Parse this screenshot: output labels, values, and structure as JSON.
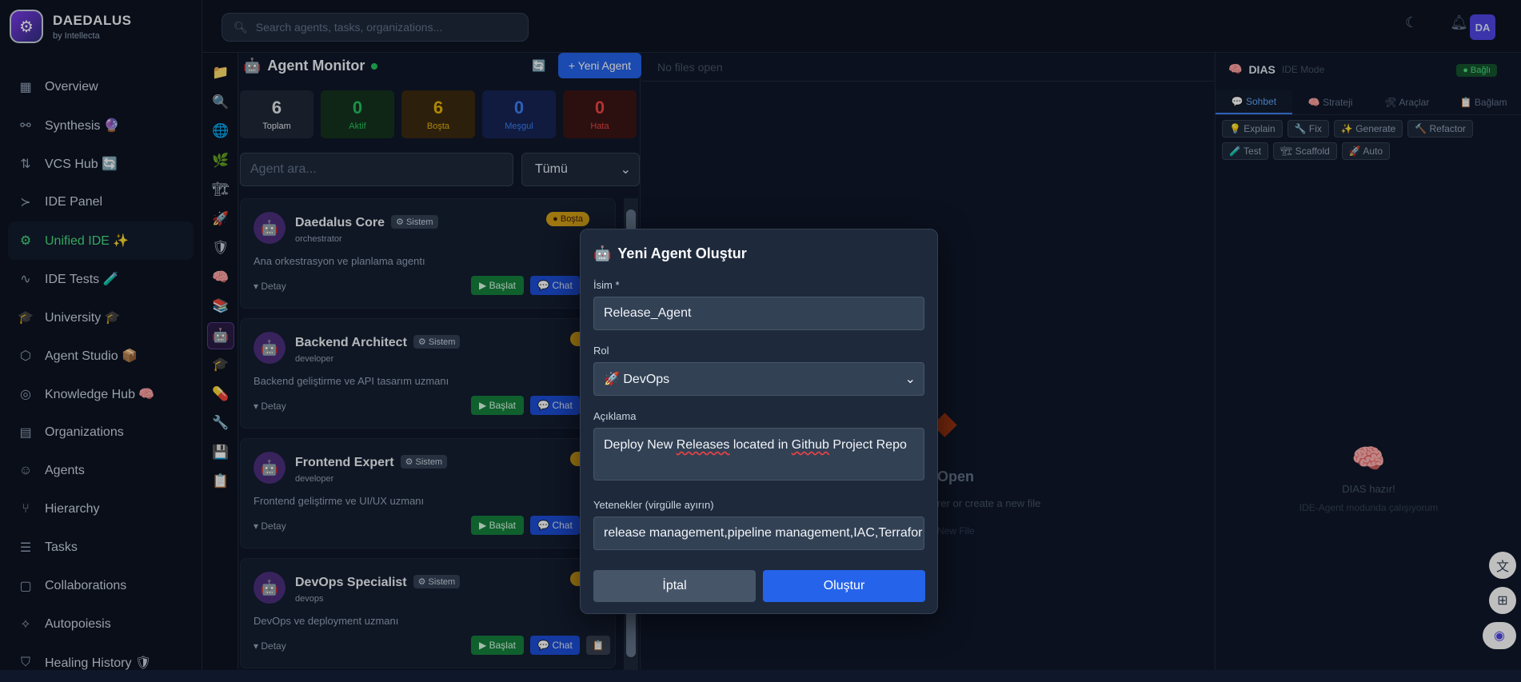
{
  "brand": {
    "title": "DAEDALUS",
    "subtitle": "by Intellecta"
  },
  "search": {
    "placeholder": "Search agents, tasks, organizations..."
  },
  "user": {
    "initials": "DA"
  },
  "nav": [
    {
      "label": "Overview",
      "icon": "▦",
      "name": "overview"
    },
    {
      "label": "Synthesis 🔮",
      "icon": "⚯",
      "name": "synthesis"
    },
    {
      "label": "VCS Hub 🔄",
      "icon": "⇅",
      "name": "vcs-hub"
    },
    {
      "label": "IDE Panel",
      "icon": "≻",
      "name": "ide-panel"
    },
    {
      "label": "Unified IDE ✨",
      "icon": "⚙",
      "name": "unified-ide"
    },
    {
      "label": "IDE Tests 🧪",
      "icon": "∿",
      "name": "ide-tests"
    },
    {
      "label": "University 🎓",
      "icon": "🎓",
      "name": "university"
    },
    {
      "label": "Agent Studio 📦",
      "icon": "⬡",
      "name": "agent-studio"
    },
    {
      "label": "Knowledge Hub 🧠",
      "icon": "◎",
      "name": "knowledge-hub"
    },
    {
      "label": "Organizations",
      "icon": "▤",
      "name": "organizations"
    },
    {
      "label": "Agents",
      "icon": "☺",
      "name": "agents"
    },
    {
      "label": "Hierarchy",
      "icon": "⑂",
      "name": "hierarchy"
    },
    {
      "label": "Tasks",
      "icon": "☰",
      "name": "tasks"
    },
    {
      "label": "Collaborations",
      "icon": "▢",
      "name": "collaborations"
    },
    {
      "label": "Autopoiesis",
      "icon": "✧",
      "name": "autopoiesis"
    },
    {
      "label": "Healing History 🛡",
      "icon": "⛉",
      "name": "healing-history"
    }
  ],
  "rail": [
    "📁",
    "🔍",
    "🌐",
    "🌿",
    "🏗",
    "🚀",
    "🛡",
    "🧠",
    "📚",
    "🤖",
    "🎓",
    "💊",
    "🔧",
    "💾",
    "📋"
  ],
  "monitor": {
    "title": "Agent Monitor",
    "new_agent": "+ Yeni Agent",
    "search_placeholder": "Agent ara...",
    "filter": "Tümü",
    "stats": [
      {
        "value": "6",
        "label": "Toplam",
        "bg": "#1f2937",
        "color": "#e5e7eb"
      },
      {
        "value": "0",
        "label": "Aktif",
        "bg": "#14331f",
        "color": "#22c55e"
      },
      {
        "value": "6",
        "label": "Boşta",
        "bg": "#3b2a10",
        "color": "#eab308"
      },
      {
        "value": "0",
        "label": "Meşgul",
        "bg": "#172554",
        "color": "#3b82f6"
      },
      {
        "value": "0",
        "label": "Hata",
        "bg": "#3b1515",
        "color": "#ef4444"
      }
    ],
    "cards": [
      {
        "name": "Daedalus Core",
        "badge": "⚙ Sistem",
        "role": "orchestrator",
        "desc": "Ana orkestrasyon ve planlama agentı",
        "detail": "▾ Detay",
        "start": "▶ Başlat",
        "chat": "💬 Chat",
        "state": "● Boşta"
      },
      {
        "name": "Backend Architect",
        "badge": "⚙ Sistem",
        "role": "developer",
        "desc": "Backend geliştirme ve API tasarım uzmanı",
        "detail": "▾ Detay",
        "start": "▶ Başlat",
        "chat": "💬 Chat",
        "state": ""
      },
      {
        "name": "Frontend Expert",
        "badge": "⚙ Sistem",
        "role": "developer",
        "desc": "Frontend geliştirme ve UI/UX uzmanı",
        "detail": "▾ Detay",
        "start": "▶ Başlat",
        "chat": "💬 Chat",
        "state": ""
      },
      {
        "name": "DevOps Specialist",
        "badge": "⚙ Sistem",
        "role": "devops",
        "desc": "DevOps ve deployment uzmanı",
        "detail": "▾ Detay",
        "start": "▶ Başlat",
        "chat": "💬 Chat",
        "state": ""
      }
    ]
  },
  "editor": {
    "no_files": "No files open",
    "empty_title": "Open",
    "empty_sub": "rer or create a new file",
    "empty_new": "New File"
  },
  "dias": {
    "title": "DIAS",
    "mode": "IDE Mode",
    "status": "Bağlı",
    "tabs": [
      "💬 Sohbet",
      "🧠 Strateji",
      "🛠 Araçlar",
      "📋 Bağlam"
    ],
    "tools": [
      "💡 Explain",
      "🔧 Fix",
      "✨ Generate",
      "🔨 Refactor",
      "🧪 Test",
      "🏗 Scaffold",
      "🚀 Auto"
    ],
    "ready": "DIAS hazır!",
    "desc": "IDE-Agent modunda çalışıyorum"
  },
  "modal": {
    "title": "Yeni Agent Oluştur",
    "name_label": "İsim *",
    "name_value": "Release_Agent",
    "role_label": "Rol",
    "role_value": "🚀 DevOps",
    "desc_label": "Açıklama",
    "desc_value_1": "Deploy New ",
    "desc_value_2": "Releases",
    "desc_value_3": " located in ",
    "desc_value_4": "Github",
    "desc_value_5": " Project ",
    "desc_value_6": "Repo",
    "skills_label": "Yetenekler (virgülle ayırın)",
    "skills_value": "release management,pipeline management,IAC,Terrafor",
    "cancel": "İptal",
    "create": "Oluştur"
  }
}
